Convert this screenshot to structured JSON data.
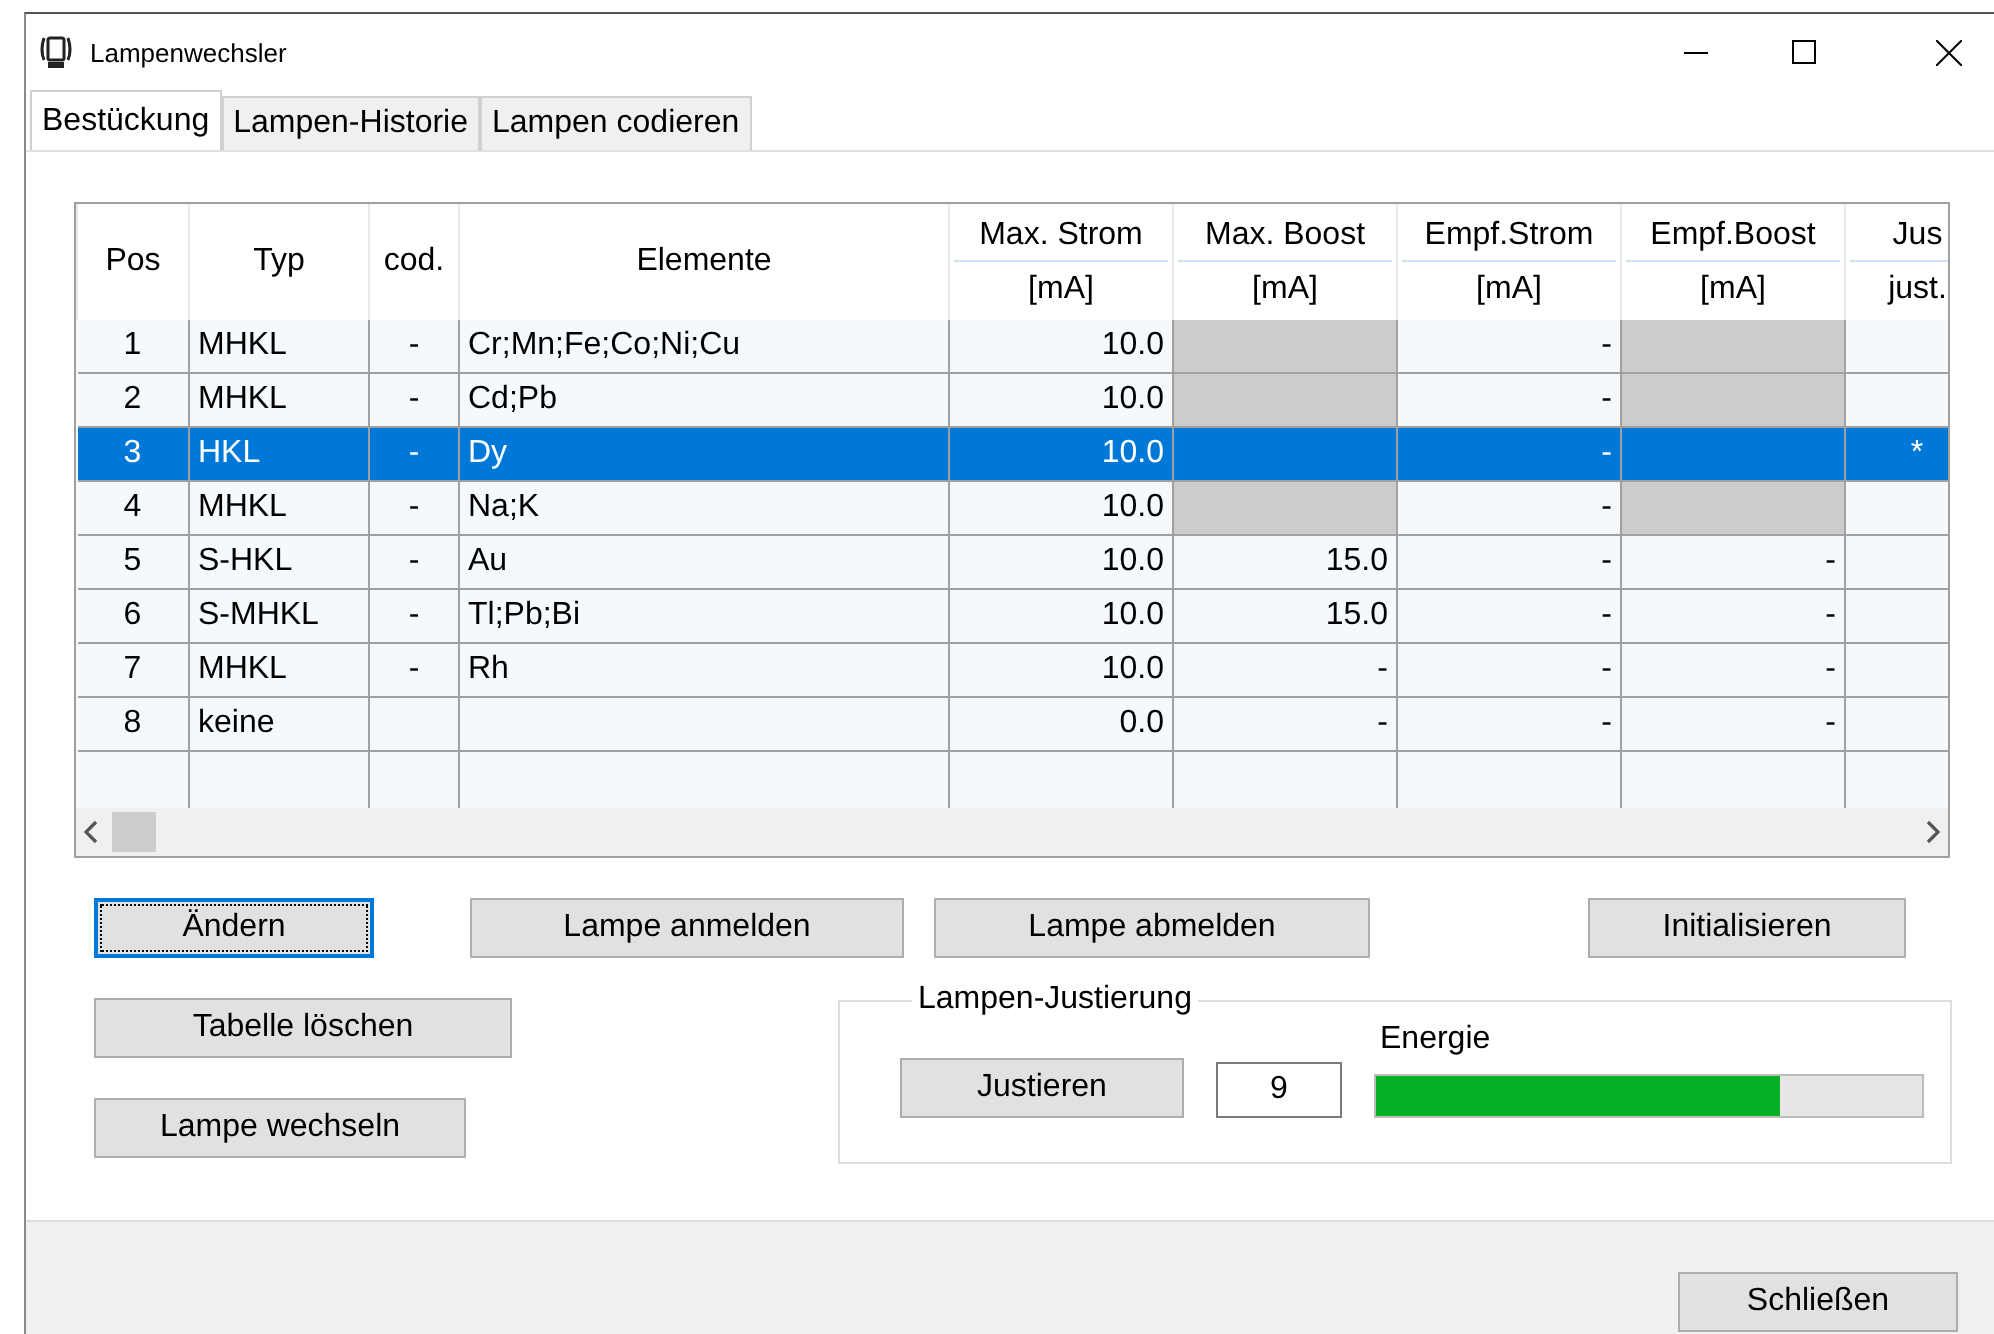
{
  "window": {
    "title": "Lampenwechsler"
  },
  "tabs": [
    {
      "label": "Bestückung",
      "selected": true
    },
    {
      "label": "Lampen-Historie",
      "selected": false
    },
    {
      "label": "Lampen codieren",
      "selected": false
    }
  ],
  "table": {
    "columns": [
      {
        "title": "Pos",
        "kind": "index"
      },
      {
        "title": "Typ",
        "kind": "text"
      },
      {
        "title": "cod.",
        "kind": "flag"
      },
      {
        "title": "Elemente",
        "kind": "text"
      },
      {
        "title": "Max. Strom",
        "unit": "[mA]",
        "kind": "number"
      },
      {
        "title": "Max. Boost",
        "unit": "[mA]",
        "kind": "number"
      },
      {
        "title": "Empf.Strom",
        "unit": "[mA]",
        "kind": "number"
      },
      {
        "title": "Empf.Boost",
        "unit": "[mA]",
        "kind": "number"
      },
      {
        "title": "Jus",
        "unit": "just.",
        "kind": "flag"
      }
    ],
    "rows": [
      {
        "cells": [
          "1",
          "MHKL",
          "-",
          "Cr;Mn;Fe;Co;Ni;Cu",
          "10.0",
          null,
          "-",
          null,
          null
        ],
        "boost_locked": true,
        "selected": false
      },
      {
        "cells": [
          "2",
          "MHKL",
          "-",
          "Cd;Pb",
          "10.0",
          null,
          "-",
          null,
          null
        ],
        "boost_locked": true,
        "selected": false
      },
      {
        "cells": [
          "3",
          "HKL",
          "-",
          "Dy",
          "10.0",
          null,
          "-",
          null,
          "*"
        ],
        "boost_locked": false,
        "selected": true
      },
      {
        "cells": [
          "4",
          "MHKL",
          "-",
          "Na;K",
          "10.0",
          null,
          "-",
          null,
          null
        ],
        "boost_locked": true,
        "selected": false
      },
      {
        "cells": [
          "5",
          "S-HKL",
          "-",
          "Au",
          "10.0",
          "15.0",
          "-",
          "-",
          null
        ],
        "boost_locked": false,
        "selected": false
      },
      {
        "cells": [
          "6",
          "S-MHKL",
          "-",
          "Tl;Pb;Bi",
          "10.0",
          "15.0",
          "-",
          "-",
          null
        ],
        "boost_locked": false,
        "selected": false
      },
      {
        "cells": [
          "7",
          "MHKL",
          "-",
          "Rh",
          "10.0",
          "-",
          "-",
          "-",
          null
        ],
        "boost_locked": false,
        "selected": false
      },
      {
        "cells": [
          "8",
          "keine",
          null,
          null,
          "0.0",
          "-",
          "-",
          "-",
          null
        ],
        "boost_locked": false,
        "selected": false
      }
    ]
  },
  "buttons_row": [
    {
      "label": "Ändern",
      "focused": true
    },
    {
      "label": "Lampe anmelden",
      "focused": false
    },
    {
      "label": "Lampe abmelden",
      "focused": false
    },
    {
      "label": "Initialisieren",
      "focused": false
    }
  ],
  "side_buttons": [
    {
      "label": "Tabelle löschen"
    },
    {
      "label": "Lampe wechseln"
    }
  ],
  "adjustment": {
    "title": "Lampen-Justierung",
    "button": "Justieren",
    "value": "9",
    "energy_label": "Energie",
    "level": 0.74
  },
  "close_button": "Schließen"
}
